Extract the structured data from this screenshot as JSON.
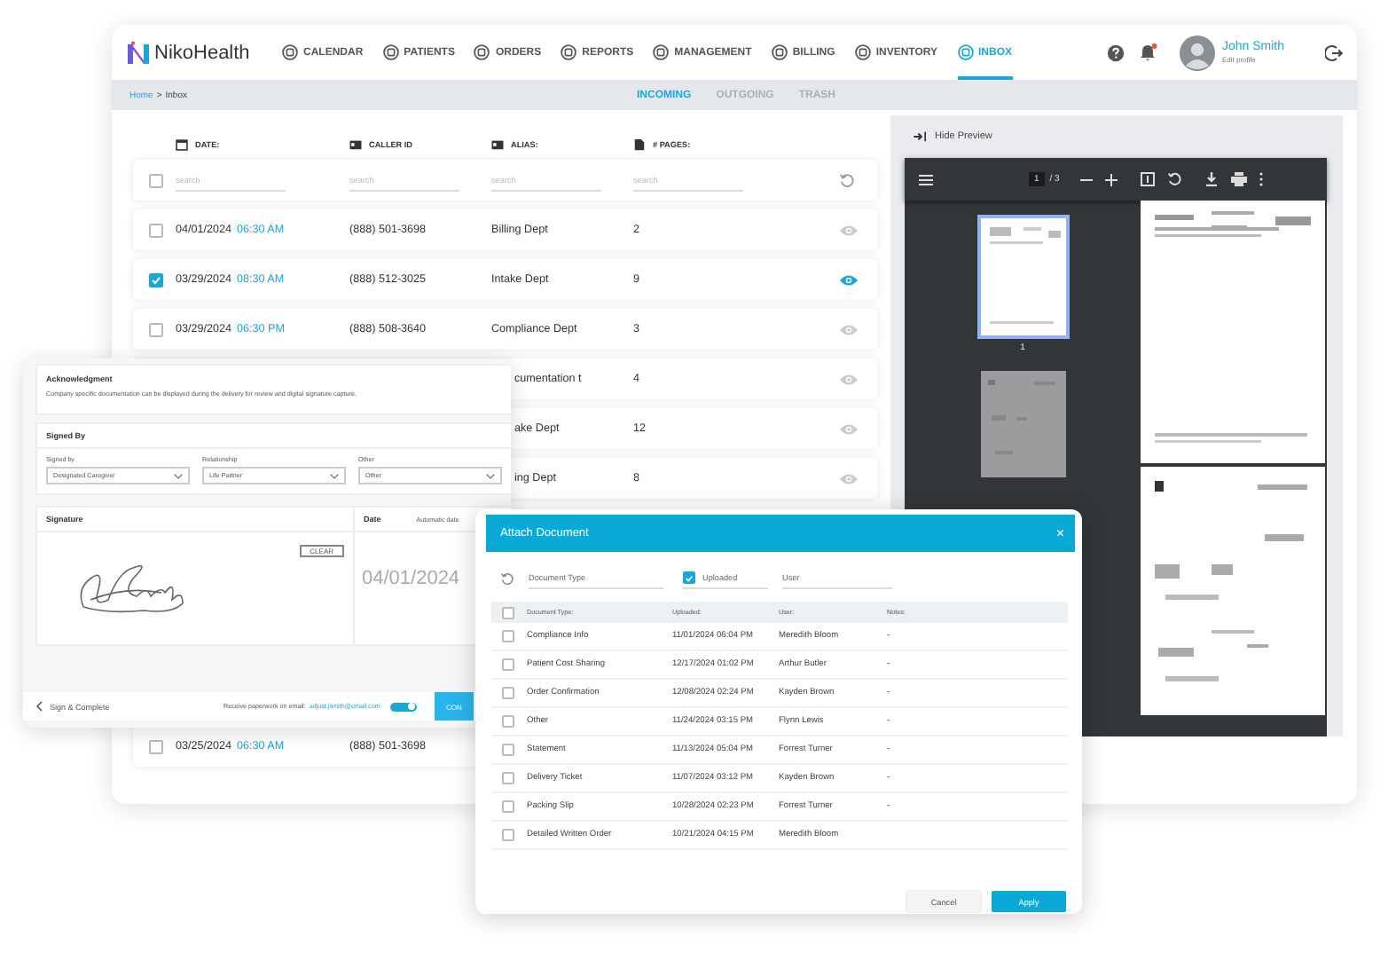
{
  "header": {
    "logo": "NikoHealth",
    "nav": [
      {
        "label": "CALENDAR",
        "selected": false
      },
      {
        "label": "PATIENTS",
        "selected": false
      },
      {
        "label": "ORDERS",
        "selected": false
      },
      {
        "label": "REPORTS",
        "selected": false
      },
      {
        "label": "MANAGEMENT",
        "selected": false
      },
      {
        "label": "BILLING",
        "selected": false
      },
      {
        "label": "INVENTORY",
        "selected": false
      },
      {
        "label": "INBOX",
        "selected": true
      }
    ],
    "has_unread": true,
    "user": {
      "name": "John Smith",
      "link": "Edit profile"
    }
  },
  "breadcrumb": {
    "link": "Home",
    "separator": ">",
    "current": "Inbox"
  },
  "folder_tabs": [
    {
      "label": "INCOMING",
      "selected": true
    },
    {
      "label": "OUTGOING",
      "selected": false
    },
    {
      "label": "TRASH",
      "selected": false
    }
  ],
  "table": {
    "columns": [
      "DATE:",
      "CALLER ID",
      "ALIAS:",
      "# PAGES:"
    ],
    "select_all": false,
    "filters": [
      {
        "placeholder": "search"
      },
      {
        "placeholder": "search"
      },
      {
        "placeholder": "search"
      },
      {
        "placeholder": "search"
      }
    ],
    "rows": [
      {
        "checked": false,
        "date": "04/01/2024",
        "time": "06:30 AM",
        "caller_id": "(888) 501-3698",
        "alias": "Billing Dept",
        "pages": "2",
        "previewing": false
      },
      {
        "checked": true,
        "date": "03/29/2024",
        "time": "08:30 AM",
        "caller_id": "(888) 512-3025",
        "alias": "Intake Dept",
        "pages": "9",
        "previewing": true
      },
      {
        "checked": false,
        "date": "03/29/2024",
        "time": "06:30 PM",
        "caller_id": "(888) 508-3640",
        "alias": "Compliance Dept",
        "pages": "3",
        "previewing": false
      },
      {
        "alias": "cumentation t",
        "pages": "4",
        "previewing": false
      },
      {
        "alias": "ake Dept",
        "pages": "12",
        "previewing": false
      },
      {
        "alias": "ing Dept",
        "pages": "8",
        "previewing": false
      },
      {
        "checked": false,
        "date": "03/25/2024",
        "time": "06:30 AM",
        "caller_id": "(888) 501-3698"
      }
    ]
  },
  "preview": {
    "hide_label": "Hide Preview",
    "page": "1",
    "page_total": "/ 3",
    "thumb_label": "1"
  },
  "signature_form": {
    "acknowledgment": {
      "title": "Acknowledgment",
      "text": "Company specific documentation can be displayed during the delivery for review and digital signature capture."
    },
    "signed_by": {
      "title": "Signed By",
      "fields": [
        {
          "label": "Signed by",
          "value": "Designated Caregiver"
        },
        {
          "label": "Relationship",
          "value": "Life Partner"
        },
        {
          "label": "Other",
          "value": "Other"
        }
      ]
    },
    "signature": {
      "title": "Signature",
      "clear": "CLEAR"
    },
    "date": {
      "title": "Date",
      "auto_label": "Automatic date",
      "value": "04/01/2024"
    },
    "footer": {
      "back": "Sign & Complete",
      "email_label": "Receive paperwork on email:",
      "email": "adjust.jsmith@email.com",
      "email_on": true,
      "button": "CON"
    }
  },
  "attach_dialog": {
    "title": "Attach Document",
    "close": "×",
    "filters": [
      {
        "kind": "text",
        "placeholder": "Document Type"
      },
      {
        "kind": "checkbox",
        "label": "Uploaded",
        "checked": true
      },
      {
        "kind": "text",
        "placeholder": "User"
      }
    ],
    "select_all": false,
    "columns": [
      "Document Type:",
      "Uploaded:",
      "User:",
      "Notes:"
    ],
    "rows": [
      {
        "checked": false,
        "type": "Compliance Info",
        "uploaded": "11/01/2024 06:04 PM",
        "user": "Meredith Bloom",
        "notes": "-"
      },
      {
        "checked": false,
        "type": "Patient Cost Sharing",
        "uploaded": "12/17/2024 01:02 PM",
        "user": "Arthur Butler",
        "notes": "-"
      },
      {
        "checked": false,
        "type": "Order Confirmation",
        "uploaded": "12/08/2024 02:24 PM",
        "user": "Kayden Brown",
        "notes": "-"
      },
      {
        "checked": false,
        "type": "Other",
        "uploaded": "11/24/2024 03:15 PM",
        "user": "Flynn Lewis",
        "notes": "-"
      },
      {
        "checked": false,
        "type": "Statement",
        "uploaded": "11/13/2024 05:04 PM",
        "user": "Forrest Turner",
        "notes": "-"
      },
      {
        "checked": false,
        "type": "Delivery Ticket",
        "uploaded": "11/07/2024 03:12 PM",
        "user": "Kayden Brown",
        "notes": "-"
      },
      {
        "checked": false,
        "type": "Packing Slip",
        "uploaded": "10/28/2024 02:23 PM",
        "user": "Forrest Turner",
        "notes": "-"
      },
      {
        "checked": false,
        "type": "Detailed Written Order",
        "uploaded": "10/21/2024 04:15 PM",
        "user": "Meredith Bloom"
      }
    ],
    "buttons": [
      {
        "label": "Cancel",
        "kind": "secondary"
      },
      {
        "label": "Apply",
        "kind": "primary"
      }
    ]
  }
}
